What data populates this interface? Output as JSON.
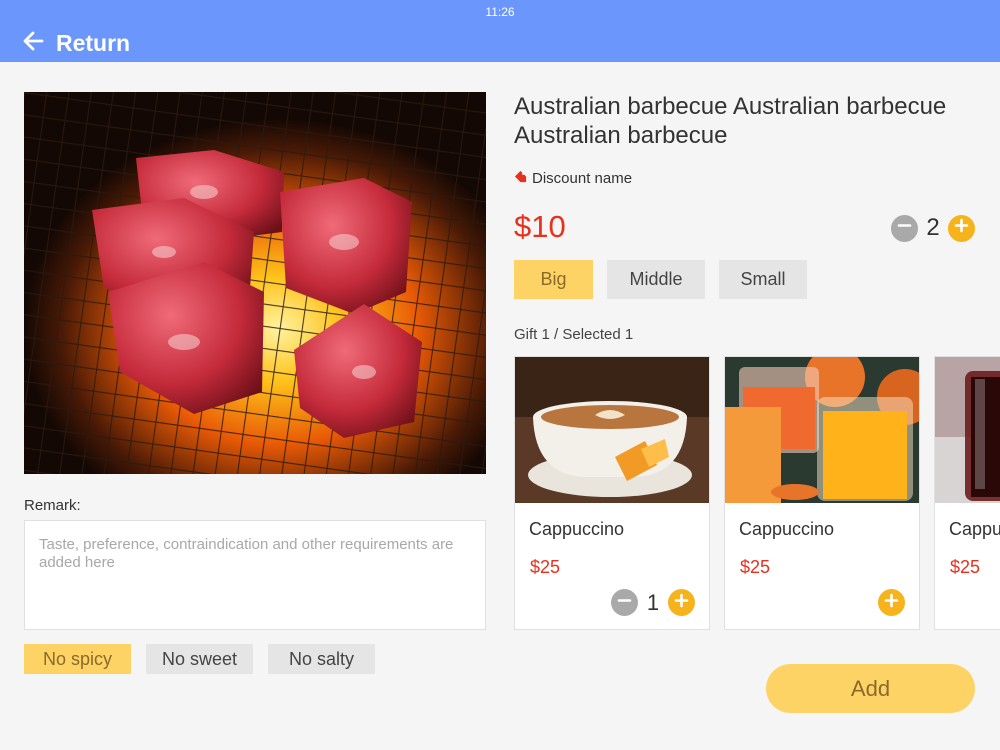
{
  "status_bar": {
    "time": "11:26"
  },
  "header": {
    "back_label": "Return",
    "accent_color": "#6b96fb"
  },
  "product": {
    "title": "Australian barbecue Australian barbecue Australian barbecue",
    "discount_name": "Discount name",
    "price": "$10",
    "quantity": "2",
    "image_icon": "grilled-meat-photo"
  },
  "sizes": [
    {
      "label": "Big",
      "selected": true
    },
    {
      "label": "Middle",
      "selected": false
    },
    {
      "label": "Small",
      "selected": false
    }
  ],
  "gift": {
    "summary": "Gift 1  /  Selected 1",
    "items": [
      {
        "name": "Cappuccino",
        "price": "$25",
        "quantity": "1",
        "image": "cappuccino-photo"
      },
      {
        "name": "Cappuccino",
        "price": "$25",
        "quantity": "",
        "image": "juice-photo"
      },
      {
        "name": "Cappuccino",
        "price": "$25",
        "quantity": "",
        "image": "cola-photo"
      }
    ]
  },
  "remark": {
    "label": "Remark:",
    "placeholder": "Taste, preference, contraindication and other requirements are added here",
    "value": ""
  },
  "taste_tags": [
    {
      "label": "No spicy",
      "selected": true
    },
    {
      "label": "No sweet",
      "selected": false
    },
    {
      "label": "No salty",
      "selected": false
    }
  ],
  "add_button": {
    "label": "Add"
  },
  "colors": {
    "price_red": "#e8311d",
    "selected_yellow": "#fdd366",
    "plus_orange": "#f6b31b",
    "minus_gray": "#a9a9a9"
  }
}
